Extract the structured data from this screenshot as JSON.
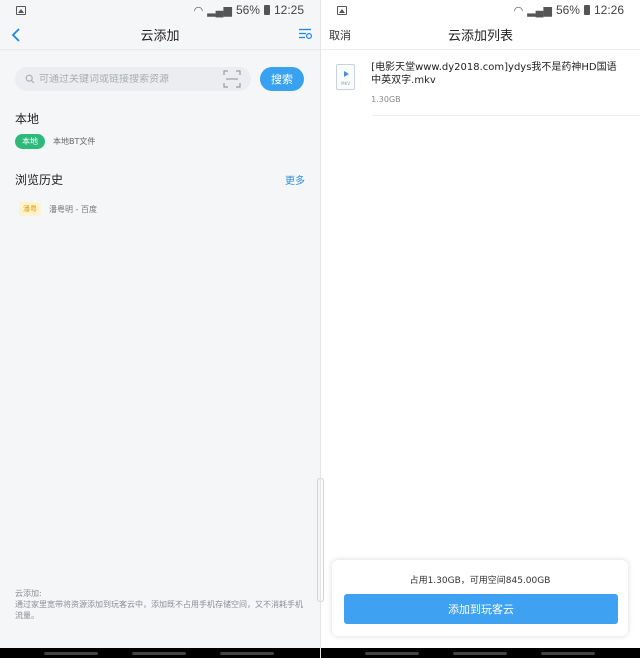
{
  "left": {
    "status": {
      "battery": "56%",
      "time": "12:25"
    },
    "nav": {
      "title": "云添加"
    },
    "search": {
      "placeholder": "可通过关键词或链接搜索资源",
      "button_label": "搜索"
    },
    "local": {
      "title": "本地",
      "badge": "本地",
      "text": "本地BT文件"
    },
    "history": {
      "title": "浏览历史",
      "more_label": "更多",
      "items": [
        {
          "badge": "潘粤",
          "text": "潘粤明 - 百度"
        }
      ]
    },
    "footer": {
      "title": "云添加:",
      "body": "通过家里宽带将资源添加到玩客云中，添加既不占用手机存储空间，又不消耗手机流量。"
    }
  },
  "right": {
    "status": {
      "battery": "56%",
      "time": "12:26"
    },
    "nav": {
      "title": "云添加列表",
      "cancel_label": "取消"
    },
    "files": [
      {
        "name": "[电影天堂www.dy2018.com]ydys我不是药神HD国语中英双字.mkv",
        "size": "1.30GB",
        "icon_ext": "MKV"
      }
    ],
    "storage_info": "占用1.30GB，可用空间845.00GB",
    "add_button_label": "添加到玩客云"
  },
  "colors": {
    "accent": "#38a1f0",
    "local_badge": "#2db87c",
    "history_badge_bg": "#fff3cf",
    "history_badge_text": "#e59b00"
  },
  "icons": {
    "back": "chevron-left-icon",
    "list": "list-icon",
    "search": "search-icon",
    "scan": "scan-icon",
    "file": "video-file-icon"
  }
}
